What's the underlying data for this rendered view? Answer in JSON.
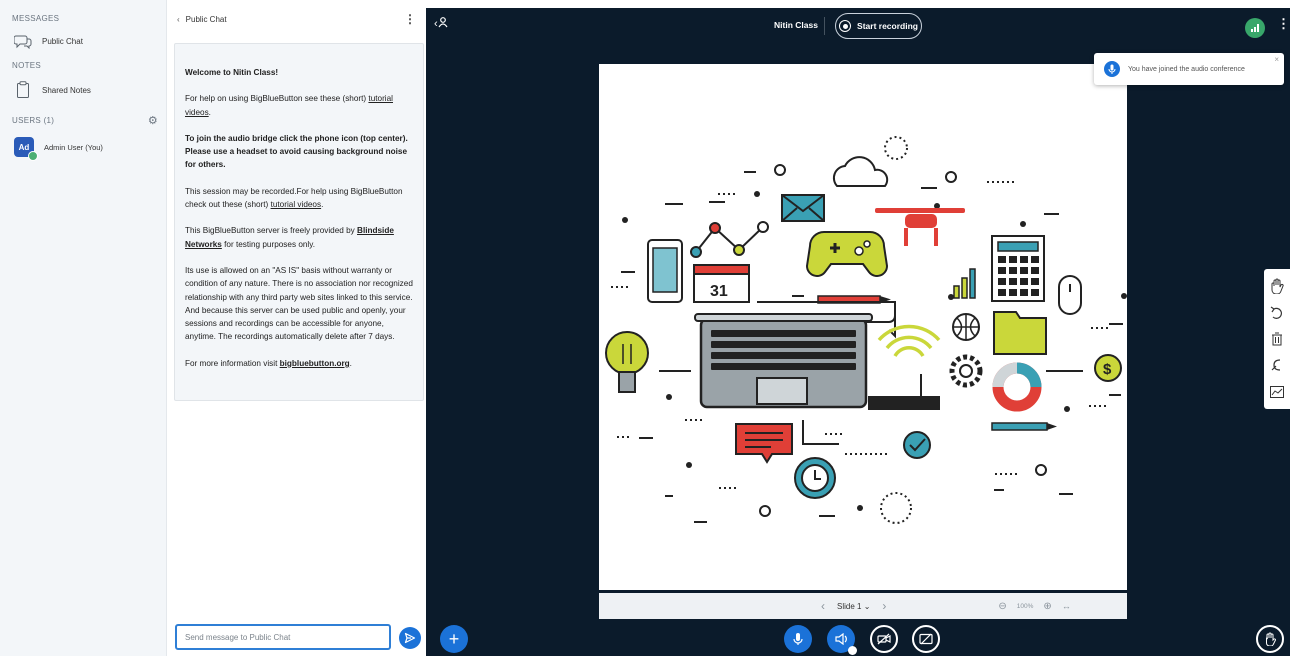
{
  "sidebar": {
    "messages_heading": "MESSAGES",
    "public_chat_label": "Public Chat",
    "notes_heading": "NOTES",
    "shared_notes_label": "Shared Notes",
    "users_heading": "USERS (1)",
    "user": {
      "initials": "Ad",
      "name": "Admin User (You)"
    }
  },
  "chat": {
    "title": "Public Chat",
    "welcome": {
      "p1": "Welcome to Nitin Class!",
      "p2a": "For help on using BigBlueButton see these (short) ",
      "p2link": "tutorial videos",
      "p2b": ".",
      "p3": "To join the audio bridge click the phone icon (top center). Please use a headset to avoid causing background noise for others.",
      "p4a": "This session may be recorded.For help using BigBlueButton check out these (short) ",
      "p4link": "tutorial videos",
      "p4b": ".",
      "p5a": "This BigBlueButton server is freely provided by ",
      "p5link": "Blindside Networks",
      "p5b": " for testing purposes only.",
      "p6": "Its use is allowed on an \"AS IS\" basis without warranty or condition of any nature. There is no association nor recognized relationship with any third party web sites linked to this service. And because this server can be used public and openly, your sessions and recordings can be accessible for anyone, anytime. The recordings automatically delete after 7 days.",
      "p7a": "For more information visit ",
      "p7link": "bigbluebutton.org",
      "p7b": "."
    },
    "input_placeholder": "Send message to Public Chat"
  },
  "header": {
    "meeting_title": "Nitin Class",
    "record_label": "Start recording"
  },
  "toast": {
    "message": "You have joined the audio conference"
  },
  "slide_bar": {
    "slide_label": "Slide 1",
    "zoom": "100%"
  },
  "colors": {
    "accent": "#1b72d8",
    "main_bg": "#0b1b2b",
    "connection": "#38a76a"
  },
  "icons": [
    "users-toggle-icon",
    "chat-icon",
    "notes-icon",
    "gear-icon",
    "send-icon",
    "record-icon",
    "connection-icon",
    "options-icon",
    "hand-tool-icon",
    "undo-icon",
    "trash-icon",
    "multi-user-icon",
    "pencil-tool-icon",
    "plus-icon",
    "mic-icon",
    "audio-icon",
    "camera-off-icon",
    "screenshare-off-icon",
    "raise-hand-icon"
  ]
}
